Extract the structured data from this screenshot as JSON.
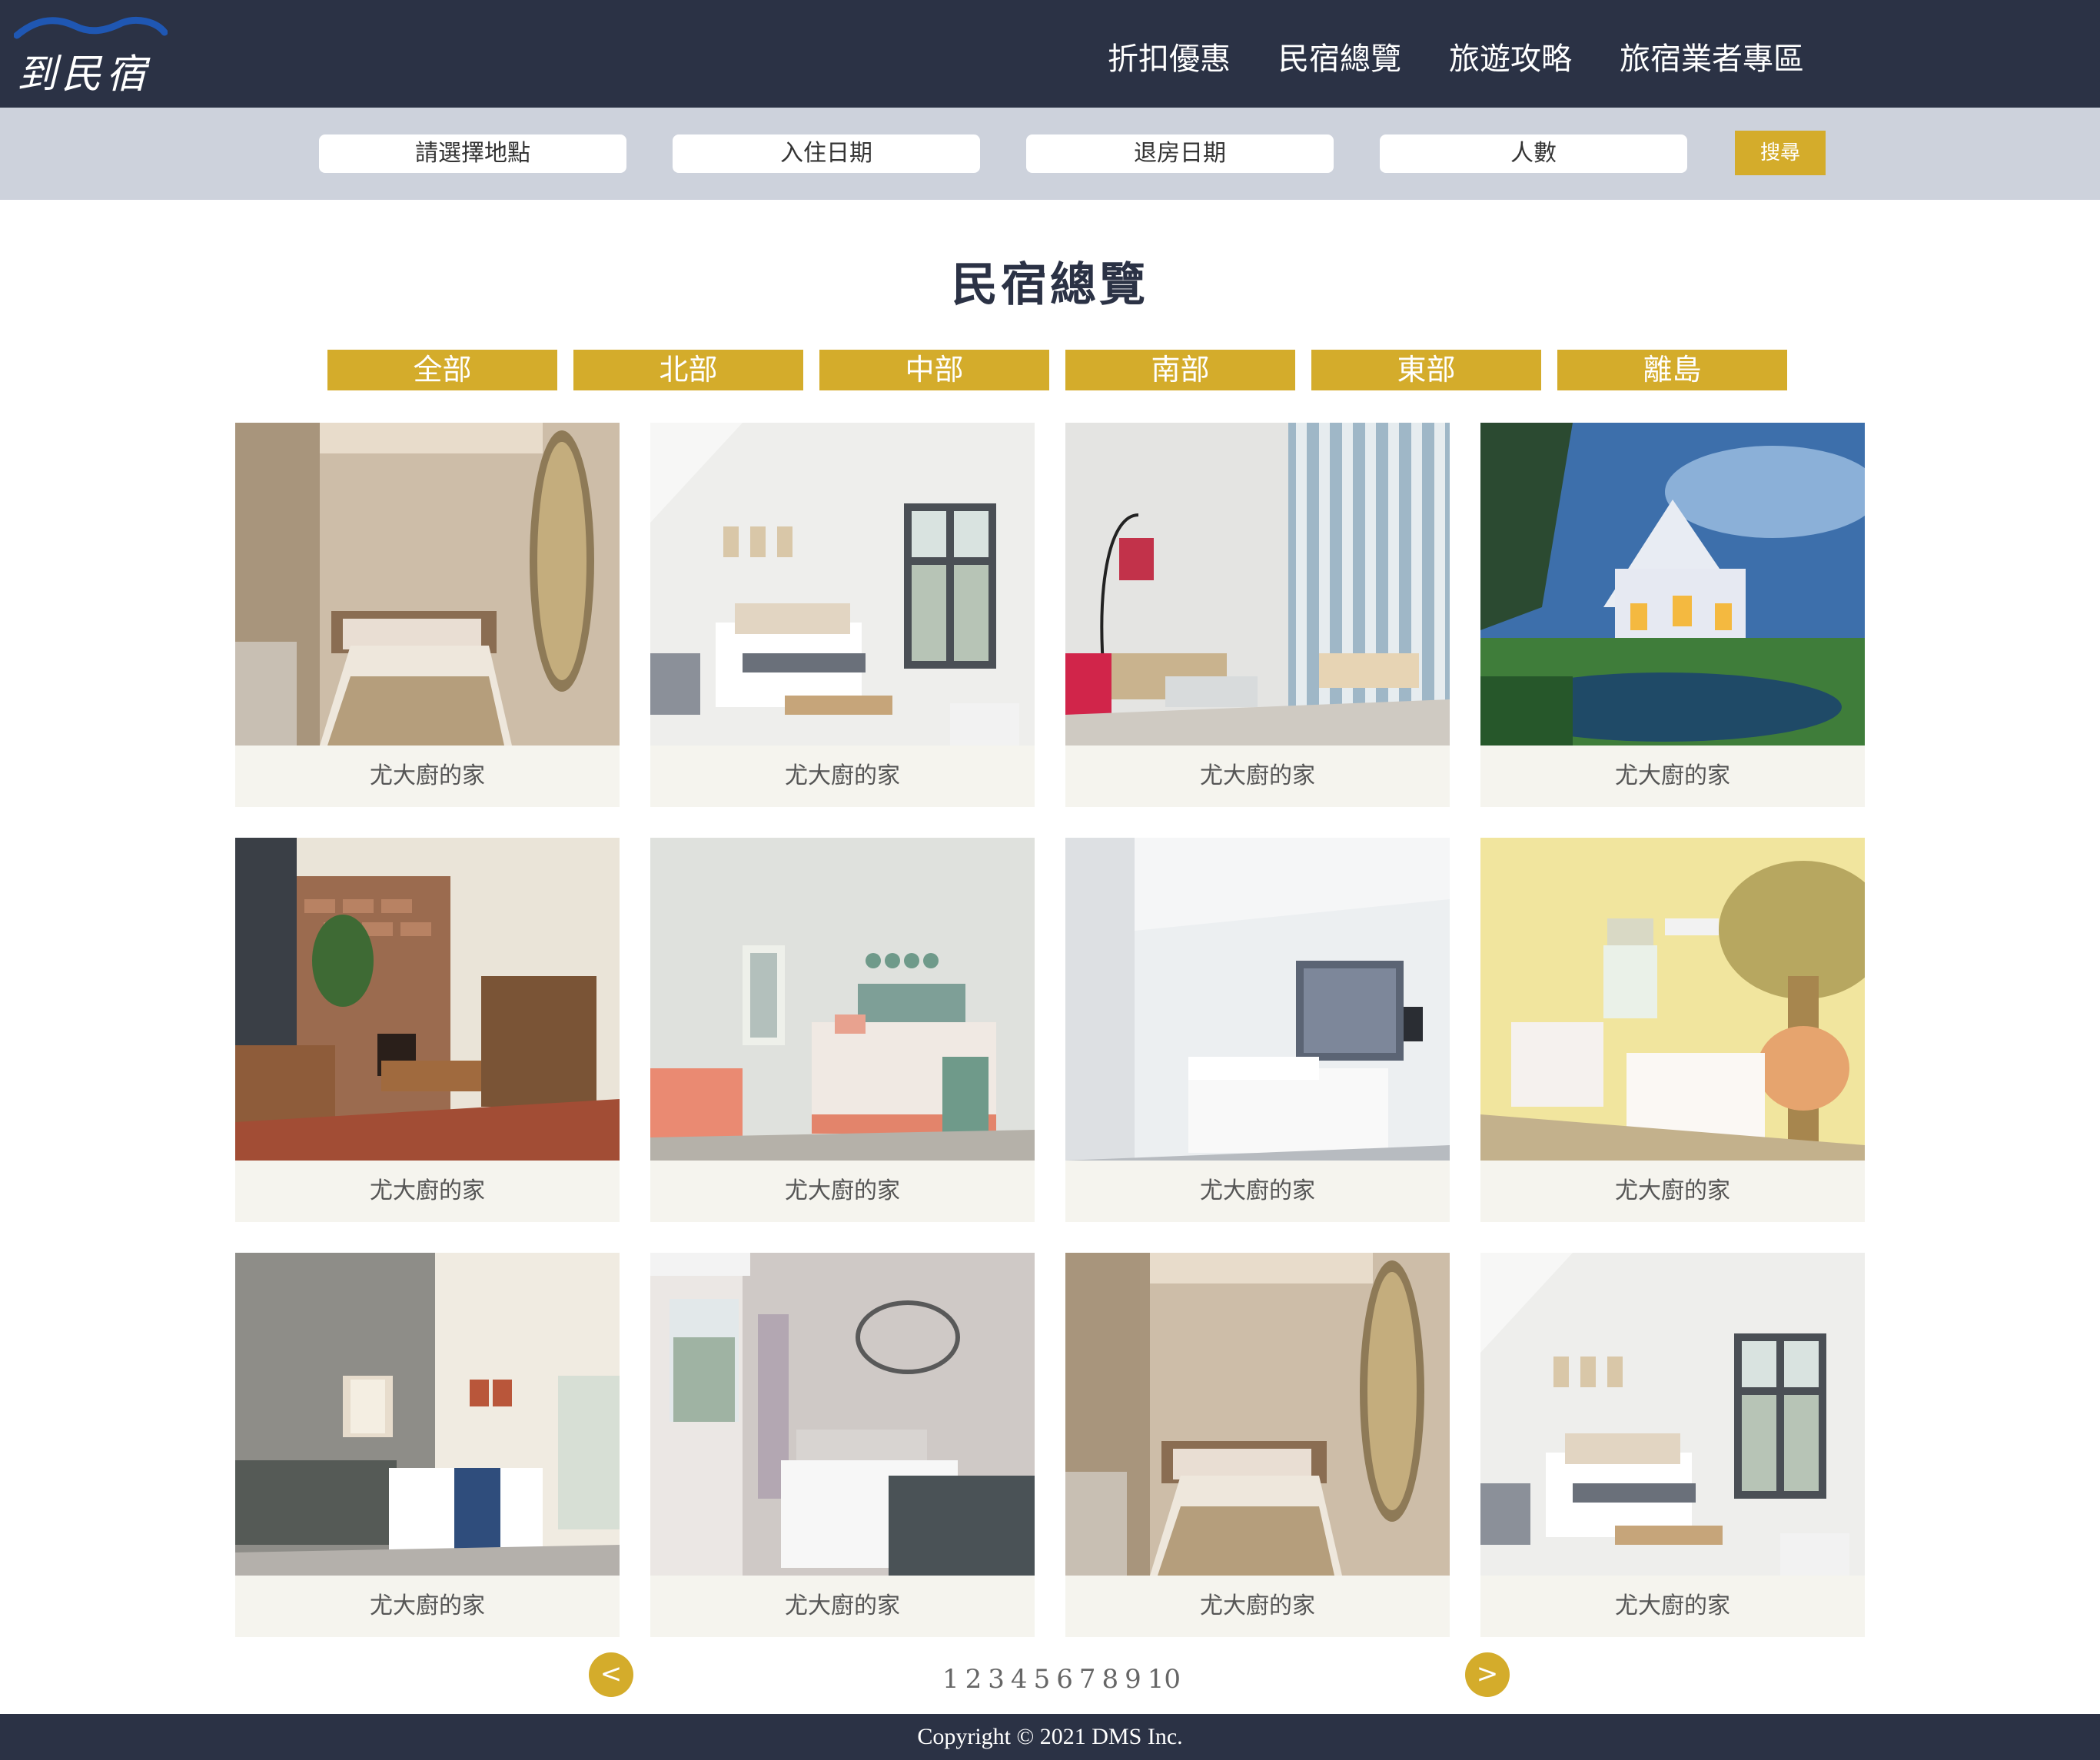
{
  "header": {
    "logo_text": "到民宿",
    "nav": [
      "折扣優惠",
      "民宿總覽",
      "旅遊攻略",
      "旅宿業者專區"
    ]
  },
  "search": {
    "location_placeholder": "請選擇地點",
    "checkin_placeholder": "入住日期",
    "checkout_placeholder": "退房日期",
    "guests_placeholder": "人數",
    "button_label": "搜尋"
  },
  "main": {
    "title": "民宿總覽",
    "filters": [
      "全部",
      "北部",
      "中部",
      "南部",
      "東部",
      "離島"
    ],
    "cards": [
      {
        "name": "尤大廚的家",
        "photo": "bedroom-mirror-photo"
      },
      {
        "name": "尤大廚的家",
        "photo": "white-bedroom-window-photo"
      },
      {
        "name": "尤大廚的家",
        "photo": "striped-living-room-photo"
      },
      {
        "name": "尤大廚的家",
        "photo": "house-at-night-pond-photo"
      },
      {
        "name": "尤大廚的家",
        "photo": "brick-fireplace-lounge-photo"
      },
      {
        "name": "尤大廚的家",
        "photo": "teal-headboard-bedroom-photo"
      },
      {
        "name": "尤大廚的家",
        "photo": "modern-grey-bedroom-photo"
      },
      {
        "name": "尤大廚的家",
        "photo": "yellow-kids-mural-bedroom-photo"
      },
      {
        "name": "尤大廚的家",
        "photo": "sofa-bed-room-photo"
      },
      {
        "name": "尤大廚的家",
        "photo": "wall-art-bedroom-photo"
      },
      {
        "name": "尤大廚的家",
        "photo": "bedroom-mirror-photo"
      },
      {
        "name": "尤大廚的家",
        "photo": "white-bedroom-window-photo"
      }
    ]
  },
  "pagination": {
    "prev_label": "<",
    "next_label": ">",
    "pages": [
      "1",
      "2",
      "3",
      "4",
      "5",
      "6",
      "7",
      "8",
      "9",
      "10"
    ]
  },
  "footer": {
    "copyright": "Copyright © 2021 DMS Inc."
  },
  "colors": {
    "navy": "#2b3245",
    "gold": "#d4ac2b",
    "search_bg": "#cdd2dc",
    "card_bg": "#f5f4ee"
  }
}
